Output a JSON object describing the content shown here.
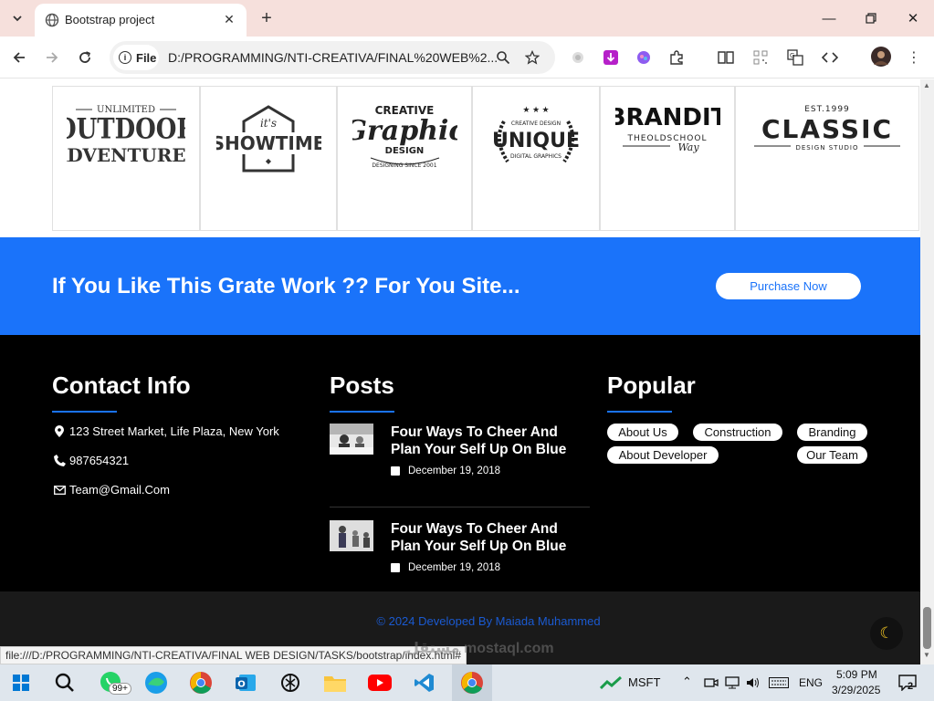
{
  "browser": {
    "tab_title": "Bootstrap project",
    "file_chip": "File",
    "address": "D:/PROGRAMMING/NTI-CREATIVA/FINAL%20WEB%2...",
    "status_url": "file:///D:/PROGRAMMING/NTI-CREATIVA/FINAL WEB DESIGN/TASKS/bootstrap/index.html#"
  },
  "logos": [
    {
      "name": "outdoor-adventures",
      "top": "UNLIMITED",
      "main": "OUTDOOR",
      "sub": "ADVENTURES"
    },
    {
      "name": "showtime",
      "top": "it's",
      "main": "SHOWTIME"
    },
    {
      "name": "creative-graphic",
      "top": "CREATIVE",
      "main": "Graphic",
      "sub": "DESIGN",
      "foot": "DESIGNING SINCE 2001"
    },
    {
      "name": "unique",
      "top": "CREATIVE DESIGN",
      "main": "UNIQUE",
      "foot": "DIGITAL GRAPHICS"
    },
    {
      "name": "brandit",
      "main": "BRANDIT",
      "sub": "THEOLDSCHOOL",
      "foot": "Way"
    },
    {
      "name": "classic",
      "top": "EST.1999",
      "main": "CLASSIC",
      "sub": "DESIGN STUDIO"
    }
  ],
  "cta": {
    "text": "If You Like This Grate Work ?? For You Site...",
    "button": "Purchase Now"
  },
  "footer": {
    "contact": {
      "heading": "Contact Info",
      "address": "123 Street Market, Life Plaza, New York",
      "phone": "987654321",
      "email": "Team@Gmail.Com"
    },
    "posts": {
      "heading": "Posts",
      "items": [
        {
          "title": "Four Ways To Cheer And Plan Your Self Up On Blue",
          "date": "December 19, 2018"
        },
        {
          "title": "Four Ways To Cheer And Plan Your Self Up On Blue",
          "date": "December 19, 2018"
        }
      ]
    },
    "popular": {
      "heading": "Popular",
      "tags": [
        "About Us",
        "Construction",
        "Branding",
        "About Developer",
        "Our Team"
      ]
    },
    "copyright": "© 2024 Developed By Maiada Muhammed"
  },
  "watermark": "مستقل mostaql.com",
  "taskbar": {
    "whatsapp_badge": "99+",
    "stock": "MSFT",
    "language": "ENG",
    "time": "5:09 PM",
    "date": "3/29/2025",
    "notifications": "2"
  },
  "colors": {
    "brand_blue": "#1a73fa",
    "footer_bg": "#000000",
    "copyright_bg": "#1a1a1a",
    "tab_bar": "#f6e0dc"
  }
}
